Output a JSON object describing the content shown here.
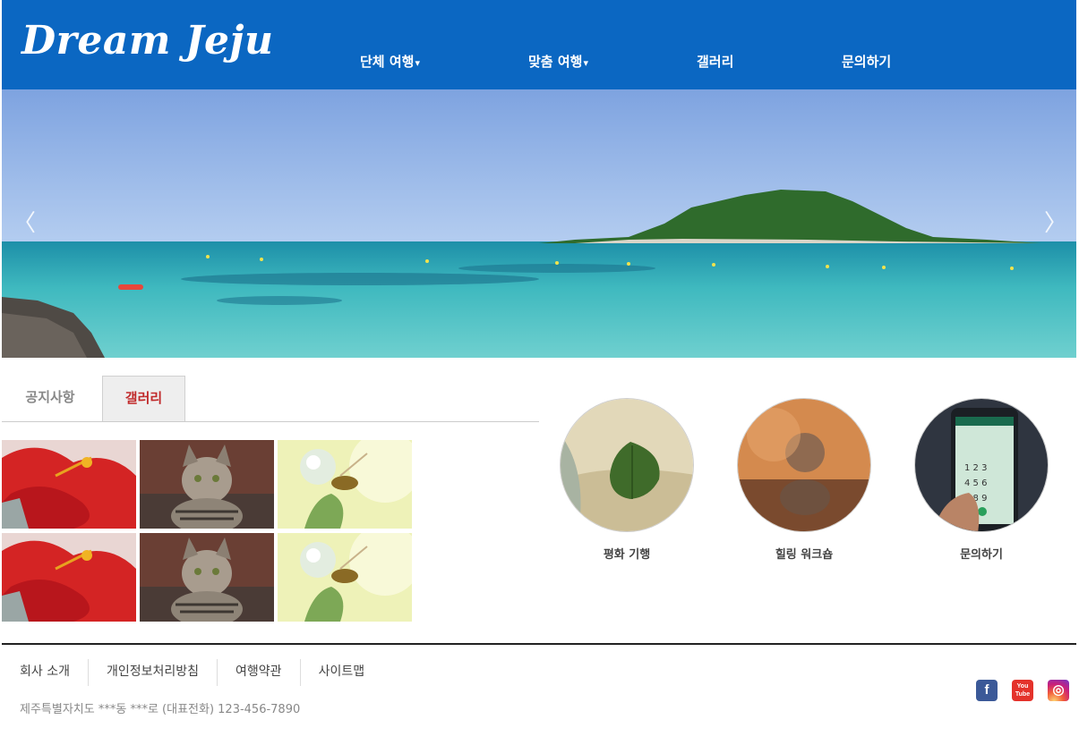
{
  "header": {
    "logo": "Dream Jeju",
    "nav": [
      {
        "label": "단체 여행",
        "caret": "▾"
      },
      {
        "label": "맞춤 여행",
        "caret": "▾"
      },
      {
        "label": "갤러리"
      },
      {
        "label": "문의하기"
      }
    ],
    "brand_color": "#0b67c2"
  },
  "hero": {
    "prev_arrow": "〈",
    "next_arrow": "〉"
  },
  "tabs": {
    "items": [
      "공지사항",
      "갤러리"
    ],
    "active": "갤러리",
    "active_color": "#c0292a"
  },
  "gallery": {
    "thumbnails": [
      "hibiscus-flower",
      "tabby-kitten",
      "bee-on-clover",
      "hibiscus-flower",
      "tabby-kitten",
      "bee-on-clover"
    ]
  },
  "features": [
    {
      "label": "평화 기행",
      "image": "leaf-on-sand"
    },
    {
      "label": "힐링 워크숍",
      "image": "stacked-stones"
    },
    {
      "label": "문의하기",
      "image": "phone-dialpad"
    }
  ],
  "footer": {
    "links": [
      "회사 소개",
      "개인정보처리방침",
      "여행약관",
      "사이트맵"
    ],
    "address": "제주특별자치도 ***동 ***로 (대표전화) 123-456-7890",
    "social": [
      {
        "name": "facebook-icon",
        "glyph": "f"
      },
      {
        "name": "youtube-icon",
        "glyph": "You Tube"
      },
      {
        "name": "instagram-icon",
        "glyph": "◎"
      }
    ]
  }
}
